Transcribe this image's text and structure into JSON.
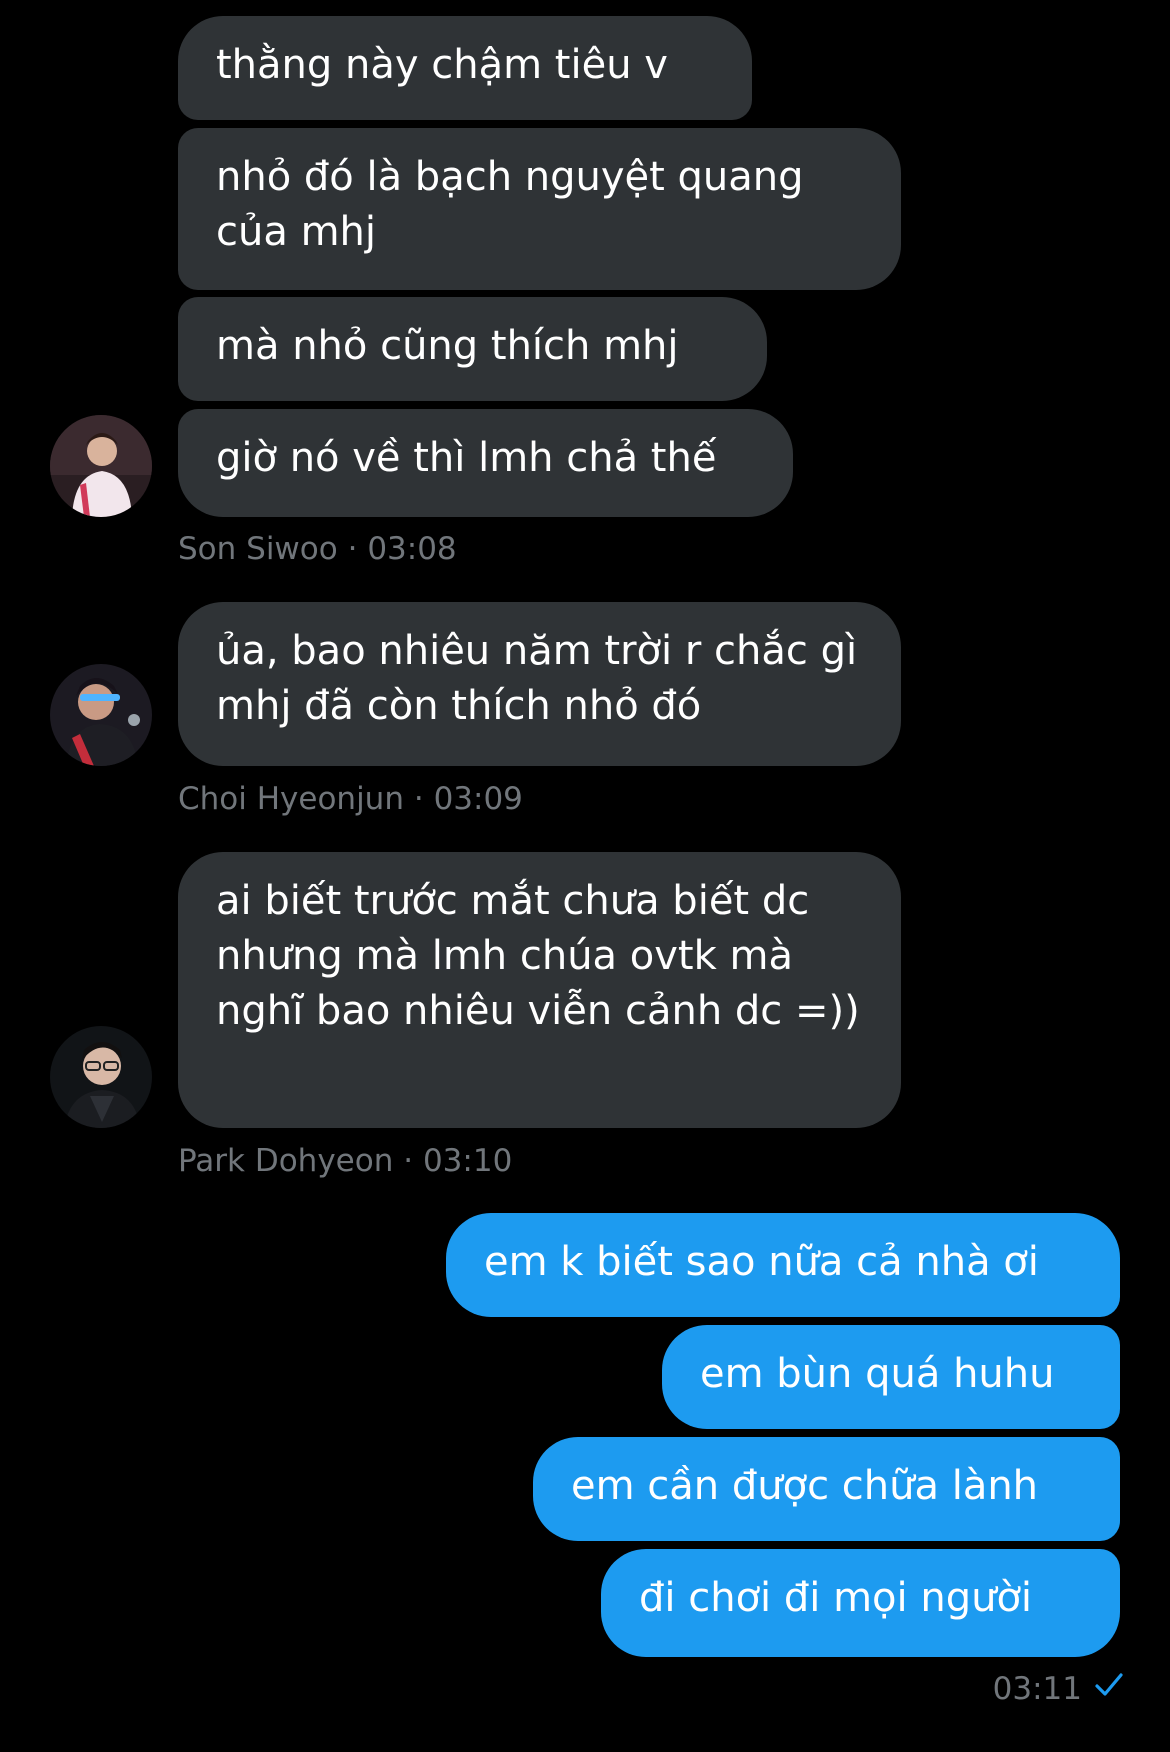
{
  "conversation": {
    "group1": {
      "messages": [
        "thằng này chậm tiêu v",
        "nhỏ đó là bạch nguyệt quang của mhj",
        "mà nhỏ cũng thích mhj",
        "giờ nó về thì lmh chả thế"
      ],
      "sender": "Son Siwoo",
      "separator": "·",
      "time": "03:08"
    },
    "group2": {
      "messages": [
        "ủa, bao nhiêu năm trời r chắc gì mhj đã còn thích nhỏ đó"
      ],
      "sender": "Choi Hyeonjun",
      "separator": "·",
      "time": "03:09"
    },
    "group3": {
      "messages": [
        "ai biết trước mắt chưa biết dc nhưng mà lmh chúa ovtk mà nghĩ bao nhiêu viễn cảnh dc =))"
      ],
      "sender": "Park Dohyeon",
      "separator": "·",
      "time": "03:10"
    },
    "outgoing": {
      "messages": [
        "em k biết sao nữa cả nhà ơi",
        "em bùn quá huhu",
        "em cần được chữa lành",
        "đi chơi đi mọi người"
      ],
      "time": "03:11",
      "status_icon": "checkmark-icon"
    }
  },
  "colors": {
    "background": "#000000",
    "incoming_bubble": "#2f3336",
    "outgoing_bubble": "#1d9bf0",
    "meta_text": "#71767b",
    "check": "#1d9bf0"
  }
}
